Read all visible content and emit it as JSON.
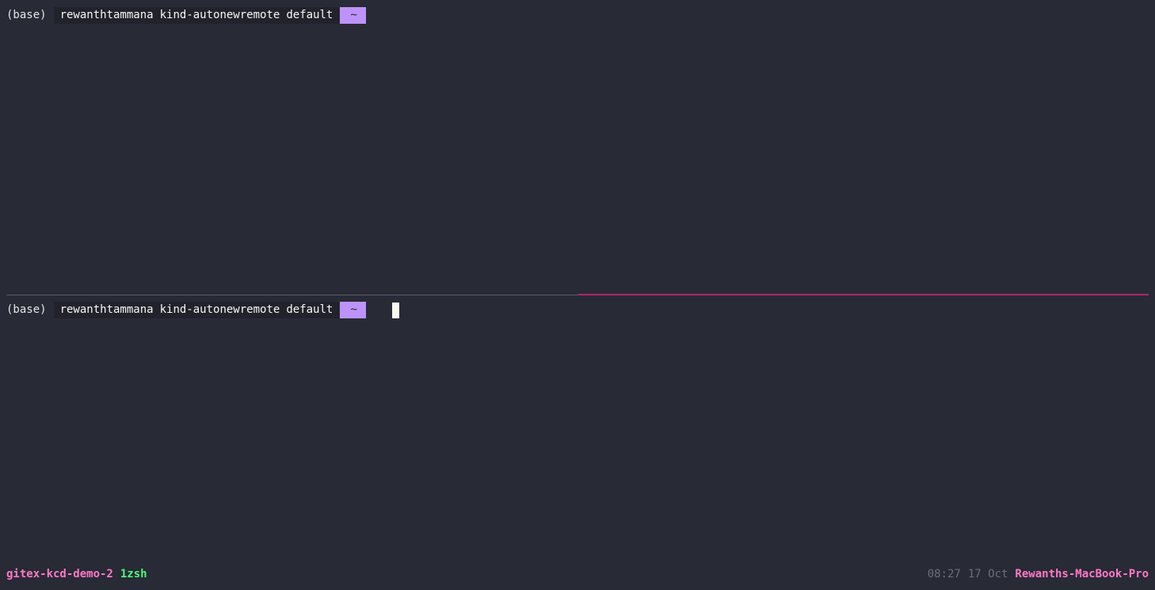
{
  "top_pane": {
    "env": "(base)",
    "user": "rewanthtammana",
    "kube_context": "kind-autonewremote",
    "namespace": "default",
    "directory": "~"
  },
  "bottom_pane": {
    "env": "(base)",
    "user": "rewanthtammana",
    "kube_context": "kind-autonewremote",
    "namespace": "default",
    "directory": "~"
  },
  "status_bar": {
    "session_name": "gitex-kcd-demo-2",
    "window_index": "1",
    "window_name": "zsh",
    "time": "08:27",
    "date": "17 Oct",
    "hostname": "Rewanths-MacBook-Pro"
  },
  "colors": {
    "background": "#282a36",
    "directory_segment": "#bd93f9",
    "active_border": "#b0266e",
    "session_name": "#ff79c6",
    "window": "#50fa7b"
  }
}
